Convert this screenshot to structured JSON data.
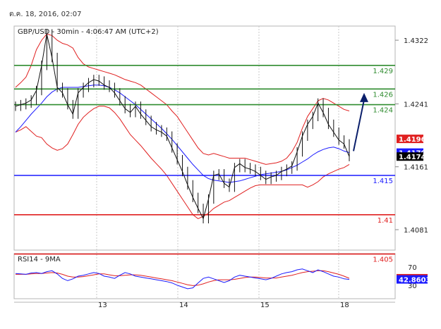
{
  "header": {
    "date": "ต.ค. 18, 2016, 02:07"
  },
  "chart_data": {
    "type": "line",
    "title": "GBP/USD - 30min - 4:06:47 AM (UTC+2)",
    "x_ticks": [
      "13",
      "14",
      "15",
      "18"
    ],
    "price_axis": {
      "ylim": [
        1.4055,
        1.434
      ],
      "ticks": [
        "1.4322",
        "1.4241",
        "1.4161",
        "1.4081"
      ]
    },
    "support_resistance": [
      {
        "value": 1.429,
        "label": "1.429",
        "color": "#2e8b2e"
      },
      {
        "value": 1.426,
        "label": "1.426",
        "color": "#2e8b2e"
      },
      {
        "value": 1.424,
        "label": "1.424",
        "color": "#2e8b2e"
      },
      {
        "value": 1.415,
        "label": "1.415",
        "color": "#1a1aff"
      },
      {
        "value": 1.41,
        "label": "1.41",
        "color": "#e02020"
      },
      {
        "value": 1.405,
        "label": "1.405",
        "color": "#e02020"
      }
    ],
    "price_tags": [
      {
        "label": "1.41965",
        "value": 1.41965,
        "color": "#e02020"
      },
      {
        "label": "1.4179",
        "value": 1.4179,
        "color": "#1a1aff"
      },
      {
        "label": "1.4174",
        "value": 1.4174,
        "color": "#000000"
      }
    ],
    "price_series": [
      1.4238,
      1.424,
      1.4242,
      1.4246,
      1.4258,
      1.429,
      1.433,
      1.43,
      1.4262,
      1.4255,
      1.424,
      1.4228,
      1.4255,
      1.4262,
      1.4268,
      1.4272,
      1.427,
      1.4265,
      1.4262,
      1.4255,
      1.4245,
      1.4235,
      1.423,
      1.4238,
      1.4228,
      1.422,
      1.4212,
      1.4208,
      1.4205,
      1.42,
      1.4185,
      1.417,
      1.4155,
      1.4138,
      1.4122,
      1.4108,
      1.4095,
      1.412,
      1.415,
      1.4152,
      1.414,
      1.4135,
      1.416,
      1.4165,
      1.416,
      1.4158,
      1.4155,
      1.415,
      1.4145,
      1.4148,
      1.415,
      1.4155,
      1.4158,
      1.4162,
      1.418,
      1.42,
      1.4215,
      1.4225,
      1.4242,
      1.423,
      1.4215,
      1.4205,
      1.4195,
      1.419,
      1.4174
    ],
    "ma_series": [
      1.4205,
      1.4212,
      1.422,
      1.4228,
      1.4235,
      1.4242,
      1.425,
      1.4256,
      1.426,
      1.4262,
      1.4262,
      1.4262,
      1.4262,
      1.4263,
      1.4264,
      1.4265,
      1.4265,
      1.4264,
      1.4262,
      1.4259,
      1.4255,
      1.425,
      1.4245,
      1.424,
      1.4234,
      1.4228,
      1.4222,
      1.4216,
      1.421,
      1.4203,
      1.4196,
      1.4188,
      1.418,
      1.4172,
      1.4164,
      1.4157,
      1.415,
      1.4146,
      1.4144,
      1.4143,
      1.4142,
      1.4141,
      1.4142,
      1.4143,
      1.4145,
      1.4147,
      1.4149,
      1.4151,
      1.4152,
      1.4153,
      1.4154,
      1.4155,
      1.4157,
      1.416,
      1.4163,
      1.4167,
      1.4171,
      1.4176,
      1.418,
      1.4183,
      1.4185,
      1.4186,
      1.4184,
      1.4181,
      1.4179
    ],
    "upper_band": [
      1.4262,
      1.4268,
      1.4275,
      1.429,
      1.431,
      1.4322,
      1.433,
      1.4328,
      1.4322,
      1.4318,
      1.4316,
      1.4312,
      1.43,
      1.4292,
      1.4288,
      1.4286,
      1.4284,
      1.4282,
      1.428,
      1.4278,
      1.4275,
      1.4272,
      1.427,
      1.4268,
      1.4265,
      1.426,
      1.4255,
      1.425,
      1.4245,
      1.424,
      1.4232,
      1.4225,
      1.4215,
      1.4205,
      1.4195,
      1.4185,
      1.4178,
      1.4176,
      1.4178,
      1.4176,
      1.4174,
      1.4172,
      1.4172,
      1.4172,
      1.4172,
      1.417,
      1.4168,
      1.4166,
      1.4164,
      1.4165,
      1.4166,
      1.4168,
      1.4172,
      1.418,
      1.4192,
      1.421,
      1.4225,
      1.4235,
      1.4245,
      1.4248,
      1.4246,
      1.4242,
      1.4238,
      1.4234,
      1.4232
    ],
    "lower_band": [
      1.4205,
      1.4208,
      1.4212,
      1.4206,
      1.42,
      1.4198,
      1.419,
      1.4185,
      1.4182,
      1.4184,
      1.419,
      1.4202,
      1.4215,
      1.4224,
      1.423,
      1.4235,
      1.4238,
      1.4238,
      1.4236,
      1.423,
      1.4222,
      1.4212,
      1.4202,
      1.4195,
      1.4188,
      1.418,
      1.4172,
      1.4165,
      1.4158,
      1.415,
      1.414,
      1.413,
      1.412,
      1.411,
      1.41,
      1.4095,
      1.4098,
      1.4102,
      1.4108,
      1.4112,
      1.4116,
      1.4118,
      1.4122,
      1.4126,
      1.413,
      1.4134,
      1.4137,
      1.4138,
      1.4138,
      1.4138,
      1.4138,
      1.4138,
      1.4138,
      1.4138,
      1.4138,
      1.4138,
      1.4135,
      1.4138,
      1.4142,
      1.4148,
      1.4152,
      1.4155,
      1.4158,
      1.416,
      1.4164
    ],
    "projection": {
      "from": 1.4181,
      "to": 1.4255
    },
    "rsi": {
      "label": "RSI14 - 9MA",
      "ylim": [
        0,
        100
      ],
      "ticks": [
        "70",
        "30"
      ],
      "tags": [
        {
          "label": "45.3924",
          "value": 45.3924,
          "color": "#e02020"
        },
        {
          "label": "42.8603",
          "value": 42.8603,
          "color": "#1a1aff"
        }
      ],
      "rsi_series": [
        56,
        55,
        54,
        57,
        58,
        56,
        60,
        62,
        55,
        45,
        40,
        44,
        50,
        52,
        55,
        58,
        56,
        50,
        48,
        45,
        52,
        58,
        55,
        50,
        48,
        46,
        44,
        42,
        40,
        38,
        35,
        30,
        26,
        22,
        24,
        35,
        45,
        48,
        44,
        40,
        36,
        40,
        48,
        52,
        50,
        48,
        46,
        44,
        42,
        45,
        50,
        55,
        58,
        60,
        64,
        66,
        62,
        58,
        64,
        60,
        55,
        50,
        48,
        44,
        42.86
      ],
      "ma_series": [
        54,
        54,
        54,
        55,
        56,
        56,
        57,
        58,
        57,
        54,
        50,
        48,
        48,
        49,
        51,
        53,
        55,
        55,
        53,
        51,
        51,
        52,
        53,
        53,
        52,
        50,
        48,
        46,
        44,
        42,
        40,
        37,
        34,
        31,
        29,
        30,
        33,
        37,
        40,
        42,
        42,
        42,
        43,
        45,
        47,
        48,
        48,
        47,
        46,
        46,
        46,
        48,
        50,
        52,
        55,
        58,
        60,
        61,
        62,
        62,
        60,
        57,
        54,
        50,
        45.39
      ]
    }
  }
}
